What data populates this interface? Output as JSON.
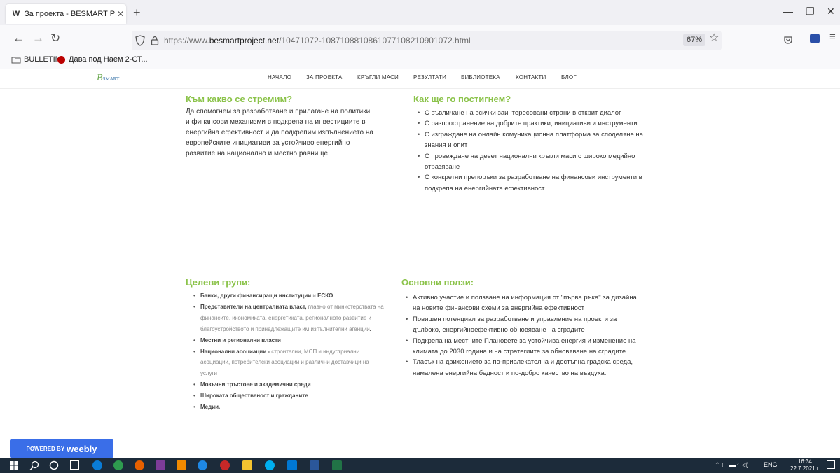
{
  "browser": {
    "tab_title": "За проекта - BESMART PROJEC",
    "tab_favicon": "W",
    "url_prefix": "https://www.",
    "url_domain": "besmartproject.net",
    "url_path": "/10471072-1087108810861077108210901072.html",
    "zoom": "67%",
    "bookmarks": [
      "BULLETIN",
      "Дава под Наем 2-СТ..."
    ]
  },
  "site": {
    "logo": "B",
    "logo_small": "SMART",
    "menu": [
      "НАЧАЛО",
      "ЗА ПРОЕКТА",
      "КРЪГЛИ МАСИ",
      "РЕЗУЛТАТИ",
      "БИБЛИОТЕКА",
      "КОНТАКТИ",
      "БЛОГ"
    ]
  },
  "sections": {
    "aim_title": "Към какво се стремим?",
    "aim_text": "Да спомогнем за разработване и прилагане на политики и финансови механизми в подкрепа на инвестициите в енергийна ефективност и да подкрепим изпълнението на европейските инициативи за устойчиво енергийно развитие на национално и местно равнище.",
    "how_title": "Как ще го постигнем?",
    "how_items": [
      "С въвличане на всички заинтересовани страни в открит диалог",
      "С разпространение на добрите практики, инициативи и инструменти",
      "С изграждане на онлайн комуникационна платформа за споделяне на знания и опит",
      "С провеждане на девет национални кръгли маси с широко медийно отразяване",
      "С конкретни препоръки за разработване на финансови инструменти в подкрепа на енергийната ефективност"
    ],
    "groups_title": "Целеви групи:",
    "groups_items": [
      {
        "bold": "Банки, други финансиращи институции",
        "rest": " и ",
        "bold2": "ЕСКО"
      },
      {
        "bold": "Представители на централната власт,",
        "rest": " главно от министерствата на финансите, икономиката, енергетиката, регионалното развитие и благоустройството и принадлежащите им изпълнителни агенции",
        "bold2": "."
      },
      {
        "bold": "Местни и регионални власти",
        "rest": "",
        "bold2": ""
      },
      {
        "bold": "Национални асоциации -",
        "rest": " строителни, МСП и индустриални асоциации, потребителски асоциации и различни доставчици на услуги",
        "bold2": ""
      },
      {
        "bold": "Мозъчни тръстове и академични среди",
        "rest": "",
        "bold2": ""
      },
      {
        "bold": "Широката общественост и гражданите",
        "rest": "",
        "bold2": ""
      },
      {
        "bold": "Медии.",
        "rest": "",
        "bold2": ""
      }
    ],
    "benefits_title": "Основни ползи:",
    "benefits_items": [
      "Активно участие и ползване на информация от \"първа ръка\" за дизайна на новите финансови схеми за енергийна ефективност",
      "Повишен потенциал за разработване и управление на проекти за дълбоко, енергийноефективно обновяване на сградите",
      "Подкрепа на местните Плановете за устойчива енергия и изменение на климата до 2030 година и на стратегиите за обновяване на сградите",
      "Тласък на движението за по-привлекателна и достъпна градска среда, намалена енергийна бедност и по-добро качество на въздуха."
    ]
  },
  "weebly": {
    "prefix": "POWERED BY",
    "brand": "weebly"
  },
  "taskbar": {
    "lang": "ENG",
    "time": "16:34",
    "date": "22.7.2021 г."
  },
  "colors": {
    "accent_green": "#8bc34a",
    "weebly_blue": "#3a6ee8",
    "taskbar": "#1c2b3a"
  }
}
